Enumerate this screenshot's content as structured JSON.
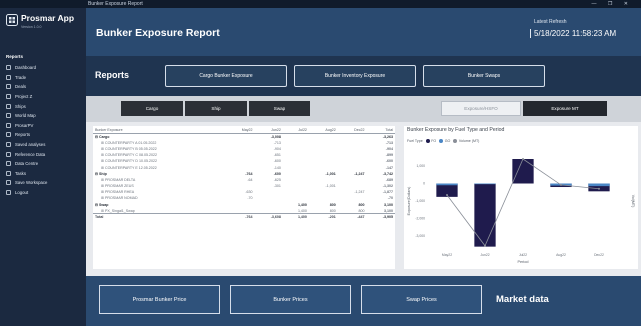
{
  "window": {
    "title": "Bunker Exposure Report",
    "controls": "— ❐ ✕"
  },
  "sidebar": {
    "app_name": "Prosmar App",
    "app_subtitle": "Version 1.0.0",
    "section": "Reports",
    "items": [
      {
        "label": "Dashboard",
        "icon": "dashboard-icon"
      },
      {
        "label": "Trade",
        "icon": "trade-icon"
      },
      {
        "label": "Deals",
        "icon": "deals-icon"
      },
      {
        "label": "Project Z",
        "icon": "project-icon"
      },
      {
        "label": "Ships",
        "icon": "ship-icon"
      },
      {
        "label": "World Map",
        "icon": "map-icon"
      },
      {
        "label": "ProsarPV",
        "icon": "chart-icon"
      },
      {
        "label": "Reports",
        "icon": "report-icon"
      },
      {
        "label": "Saved analyses",
        "icon": "analysis-icon"
      },
      {
        "label": "Reference Data",
        "icon": "database-icon"
      },
      {
        "label": "Data Centre",
        "icon": "server-icon"
      },
      {
        "label": "Tasks",
        "icon": "task-icon"
      },
      {
        "label": "Save Workspace",
        "icon": "save-icon"
      },
      {
        "label": "Logout",
        "icon": "logout-icon"
      }
    ]
  },
  "header": {
    "title": "Bunker Exposure Report",
    "user": "Latest Refresh",
    "date": "5/18/2022 11:58:23 AM"
  },
  "reports": {
    "label": "Reports",
    "buttons": [
      "Cargo Bunker Exposure",
      "Bunker Inventory Exposure",
      "Bunker Swaps"
    ]
  },
  "filters": {
    "segments": [
      "Cargo",
      "Ship",
      "Swap"
    ],
    "toggles": [
      {
        "label": "Exposure/HSFO",
        "active": false
      },
      {
        "label": "Exposure MT",
        "active": true
      }
    ]
  },
  "table": {
    "headers": [
      "Bunker Exposure",
      "May22",
      "Jun22",
      "Jul22",
      "Aug22",
      "Dec22",
      "Total"
    ],
    "rows": [
      {
        "type": "grp",
        "cells": [
          "⊟ Cargo",
          "",
          "-3,008",
          "",
          "",
          "",
          "-3,263"
        ]
      },
      {
        "type": "sub",
        "cells": [
          "⊞ COUNTERPARTY A 01.05.2022",
          "",
          "-713",
          "",
          "",
          "",
          "-713"
        ]
      },
      {
        "type": "sub",
        "cells": [
          "⊞ COUNTERPARTY B 05.05.2022",
          "",
          "-904",
          "",
          "",
          "",
          "-904"
        ]
      },
      {
        "type": "sub",
        "cells": [
          "⊞ COUNTERPARTY C 08.05.2022",
          "",
          "-651",
          "",
          "",
          "",
          "-899"
        ]
      },
      {
        "type": "sub",
        "cells": [
          "⊞ COUNTERPARTY D 10.05.2022",
          "",
          "-600",
          "",
          "",
          "",
          "-600"
        ]
      },
      {
        "type": "sub",
        "cells": [
          "⊞ COUNTERPARTY E 12.05.2022",
          "",
          "-140",
          "",
          "",
          "",
          "-147"
        ]
      },
      {
        "type": "grp",
        "cells": [
          "⊟ Ship",
          "-764",
          "-600",
          "",
          "-1,001",
          "-1,247",
          "-3,742"
        ]
      },
      {
        "type": "sub",
        "cells": [
          "⊞ PROSMAR DELTA",
          "-64",
          "-625",
          "",
          "",
          "",
          "-689"
        ]
      },
      {
        "type": "sub",
        "cells": [
          "⊞ PROSMAR ZEUS",
          "",
          "-301",
          "",
          "-1,001",
          "",
          "-1,302"
        ]
      },
      {
        "type": "sub",
        "cells": [
          "⊞ PROSMAR RHEA",
          "-630",
          "",
          "",
          "",
          "-1,247",
          "-1,877"
        ]
      },
      {
        "type": "sub",
        "cells": [
          "⊞ PROSMAR NOMAD",
          "-70",
          "",
          "",
          "",
          "",
          "-70"
        ]
      },
      {
        "type": "grp",
        "cells": [
          "⊟ Swap",
          "",
          "",
          "1,400",
          "800",
          "800",
          "3,100"
        ]
      },
      {
        "type": "sub",
        "cells": [
          "⊞ PX_Singal1_Swap",
          "",
          "",
          "1,400",
          "800",
          "800",
          "3,100"
        ]
      },
      {
        "type": "total",
        "cells": [
          "Total",
          "-764",
          "-3,608",
          "1,400",
          "-201",
          "-447",
          "-3,905"
        ]
      }
    ]
  },
  "chart_data": {
    "type": "bar",
    "title": "Bunker Exposure by Fuel Type and Period",
    "legend_title": "Fuel Type",
    "categories": [
      "May22",
      "Jun22",
      "Jul22",
      "Aug22",
      "Dec22"
    ],
    "series": [
      {
        "name": "FO",
        "color": "#1f1b4d",
        "values": [
          -764,
          -3608,
          1400,
          -201,
          -447
        ]
      },
      {
        "name": "GO",
        "color": "#4a86c5",
        "values": [
          -100,
          -40,
          0,
          -120,
          -150
        ]
      },
      {
        "name": "Volume (MT)",
        "color": "#8a8f98",
        "values": [
          -660,
          -3560,
          1400,
          -80,
          -300
        ]
      }
    ],
    "xlabel": "Period",
    "ylabel": "Exposure(Dollars)",
    "y2label": "Vol(MT)",
    "yticks": [
      1000,
      0,
      -1000,
      -2000,
      -3000
    ],
    "ylim": [
      -3800,
      1800
    ],
    "grid": false,
    "legend_position": "top-left"
  },
  "market": {
    "buttons": [
      "Prosmar Bunker Price",
      "Bunker Prices",
      "Swap Prices"
    ],
    "label": "Market data"
  }
}
